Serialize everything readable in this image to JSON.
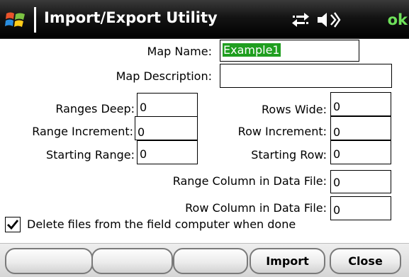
{
  "window": {
    "title": "Import/Export Utility",
    "ok_label": "ok",
    "start_icon": "windows-flag-icon",
    "connectivity_icon": "connectivity-arrows-icon",
    "volume_icon": "speaker-icon"
  },
  "form": {
    "map_name": {
      "label": "Map Name:",
      "value": "Example1"
    },
    "map_description": {
      "label": "Map Description:",
      "value": ""
    },
    "ranges_deep": {
      "label": "Ranges Deep:",
      "value": "0"
    },
    "rows_wide": {
      "label": "Rows Wide:",
      "value": "0"
    },
    "range_increment": {
      "label": "Range Increment:",
      "value": "0"
    },
    "row_increment": {
      "label": "Row Increment:",
      "value": "0"
    },
    "starting_range": {
      "label": "Starting Range:",
      "value": "0"
    },
    "starting_row": {
      "label": "Starting Row:",
      "value": "0"
    },
    "range_column": {
      "label": "Range Column in Data File:",
      "value": "0"
    },
    "row_column": {
      "label": "Row Column in Data File:",
      "value": "0"
    },
    "delete_files": {
      "label": "Delete files from the field computer when done",
      "checked": true
    }
  },
  "softkeys": {
    "key1": "",
    "key2": "",
    "key3": "",
    "import": "Import",
    "close": "Close"
  },
  "colors": {
    "titlebar": "#000000",
    "title_text": "#ffffff",
    "ok_text": "#6ee05a",
    "selection": "#1f9e1f"
  }
}
